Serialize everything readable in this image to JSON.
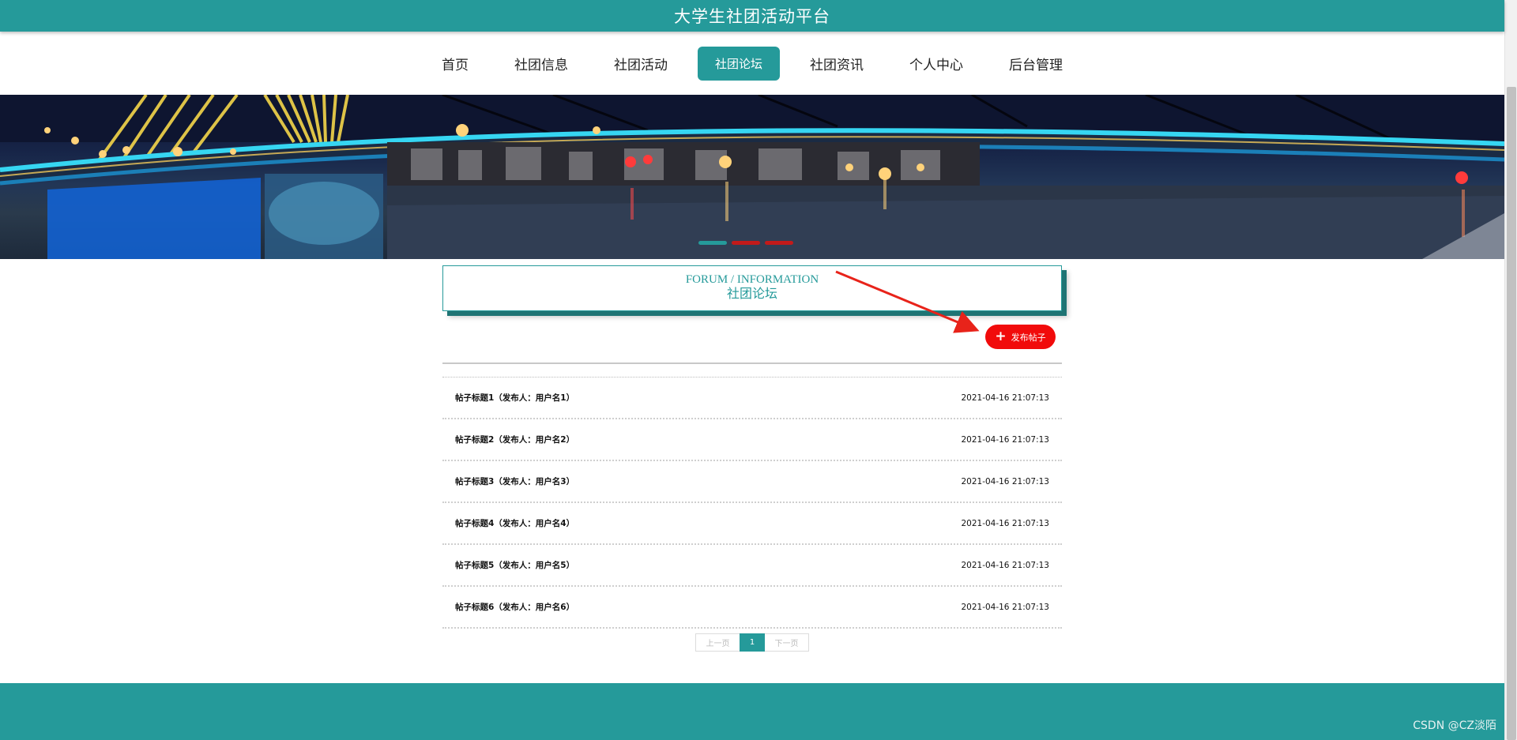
{
  "header": {
    "title": "大学生社团活动平台"
  },
  "nav": {
    "items": [
      {
        "label": "首页"
      },
      {
        "label": "社团信息"
      },
      {
        "label": "社团活动"
      },
      {
        "label": "社团论坛",
        "active": true
      },
      {
        "label": "社团资讯"
      },
      {
        "label": "个人中心"
      },
      {
        "label": "后台管理"
      }
    ]
  },
  "banner": {
    "slide_count": 3,
    "active_slide": 1,
    "image": "night-bridge-photo"
  },
  "section": {
    "title_en": "FORUM / INFORMATION",
    "title_cn": "社团论坛"
  },
  "actions": {
    "publish_label": "发布帖子",
    "publish_icon": "plus-icon"
  },
  "posts": [
    {
      "title": "帖子标题1（发布人：用户名1）",
      "time": "2021-04-16 21:07:13"
    },
    {
      "title": "帖子标题2（发布人：用户名2）",
      "time": "2021-04-16 21:07:13"
    },
    {
      "title": "帖子标题3（发布人：用户名3）",
      "time": "2021-04-16 21:07:13"
    },
    {
      "title": "帖子标题4（发布人：用户名4）",
      "time": "2021-04-16 21:07:13"
    },
    {
      "title": "帖子标题5（发布人：用户名5）",
      "time": "2021-04-16 21:07:13"
    },
    {
      "title": "帖子标题6（发布人：用户名6）",
      "time": "2021-04-16 21:07:13"
    }
  ],
  "pagination": {
    "prev_label": "上一页",
    "current": "1",
    "next_label": "下一页"
  },
  "watermark": "CSDN @CZ淡陌",
  "colors": {
    "primary": "#259a9a",
    "accent_red": "#f10b0b",
    "arrow": "#e8231a"
  }
}
